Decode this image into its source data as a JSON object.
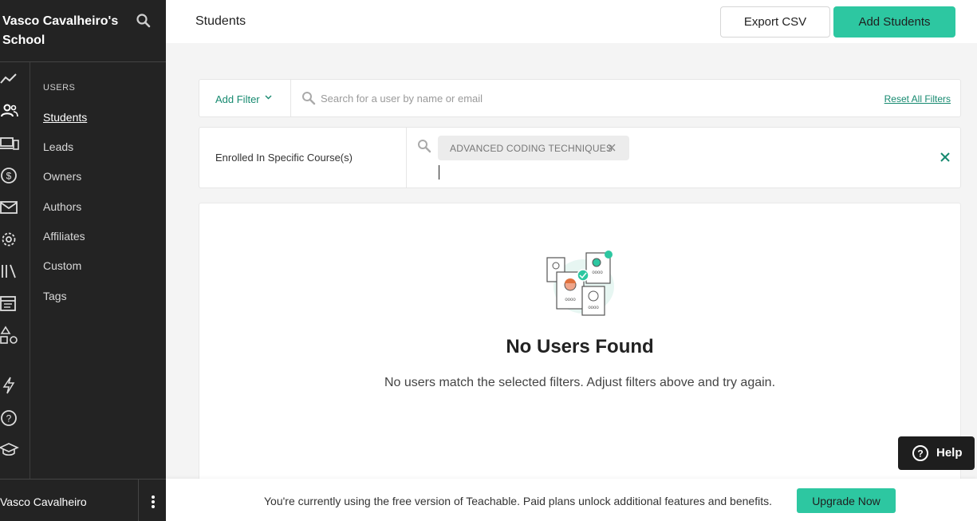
{
  "sidebar": {
    "school_name": "Vasco Cavalheiro's School",
    "section_heading": "USERS",
    "items": [
      {
        "label": "Students"
      },
      {
        "label": "Leads"
      },
      {
        "label": "Owners"
      },
      {
        "label": "Authors"
      },
      {
        "label": "Affiliates"
      },
      {
        "label": "Custom"
      },
      {
        "label": "Tags"
      }
    ],
    "user_name": "Vasco Cavalheiro"
  },
  "header": {
    "title": "Students",
    "export_label": "Export CSV",
    "add_label": "Add Students"
  },
  "filters": {
    "add_filter_label": "Add Filter",
    "search_placeholder": "Search for a user by name or email",
    "reset_label": "Reset All Filters",
    "active_filter_label": "Enrolled In Specific Course(s)",
    "chip_label": "ADVANCED CODING TECHNIQUES"
  },
  "results": {
    "empty_title": "No Users Found",
    "empty_message": "No users match the selected filters. Adjust filters above and try again."
  },
  "help": {
    "label": "Help"
  },
  "banner": {
    "text": "You're currently using the free version of Teachable. Paid plans unlock additional features and benefits.",
    "upgrade_label": "Upgrade Now"
  },
  "colors": {
    "sidebar_bg": "#232323",
    "accent": "#2dc7a1",
    "link": "#178a70"
  }
}
